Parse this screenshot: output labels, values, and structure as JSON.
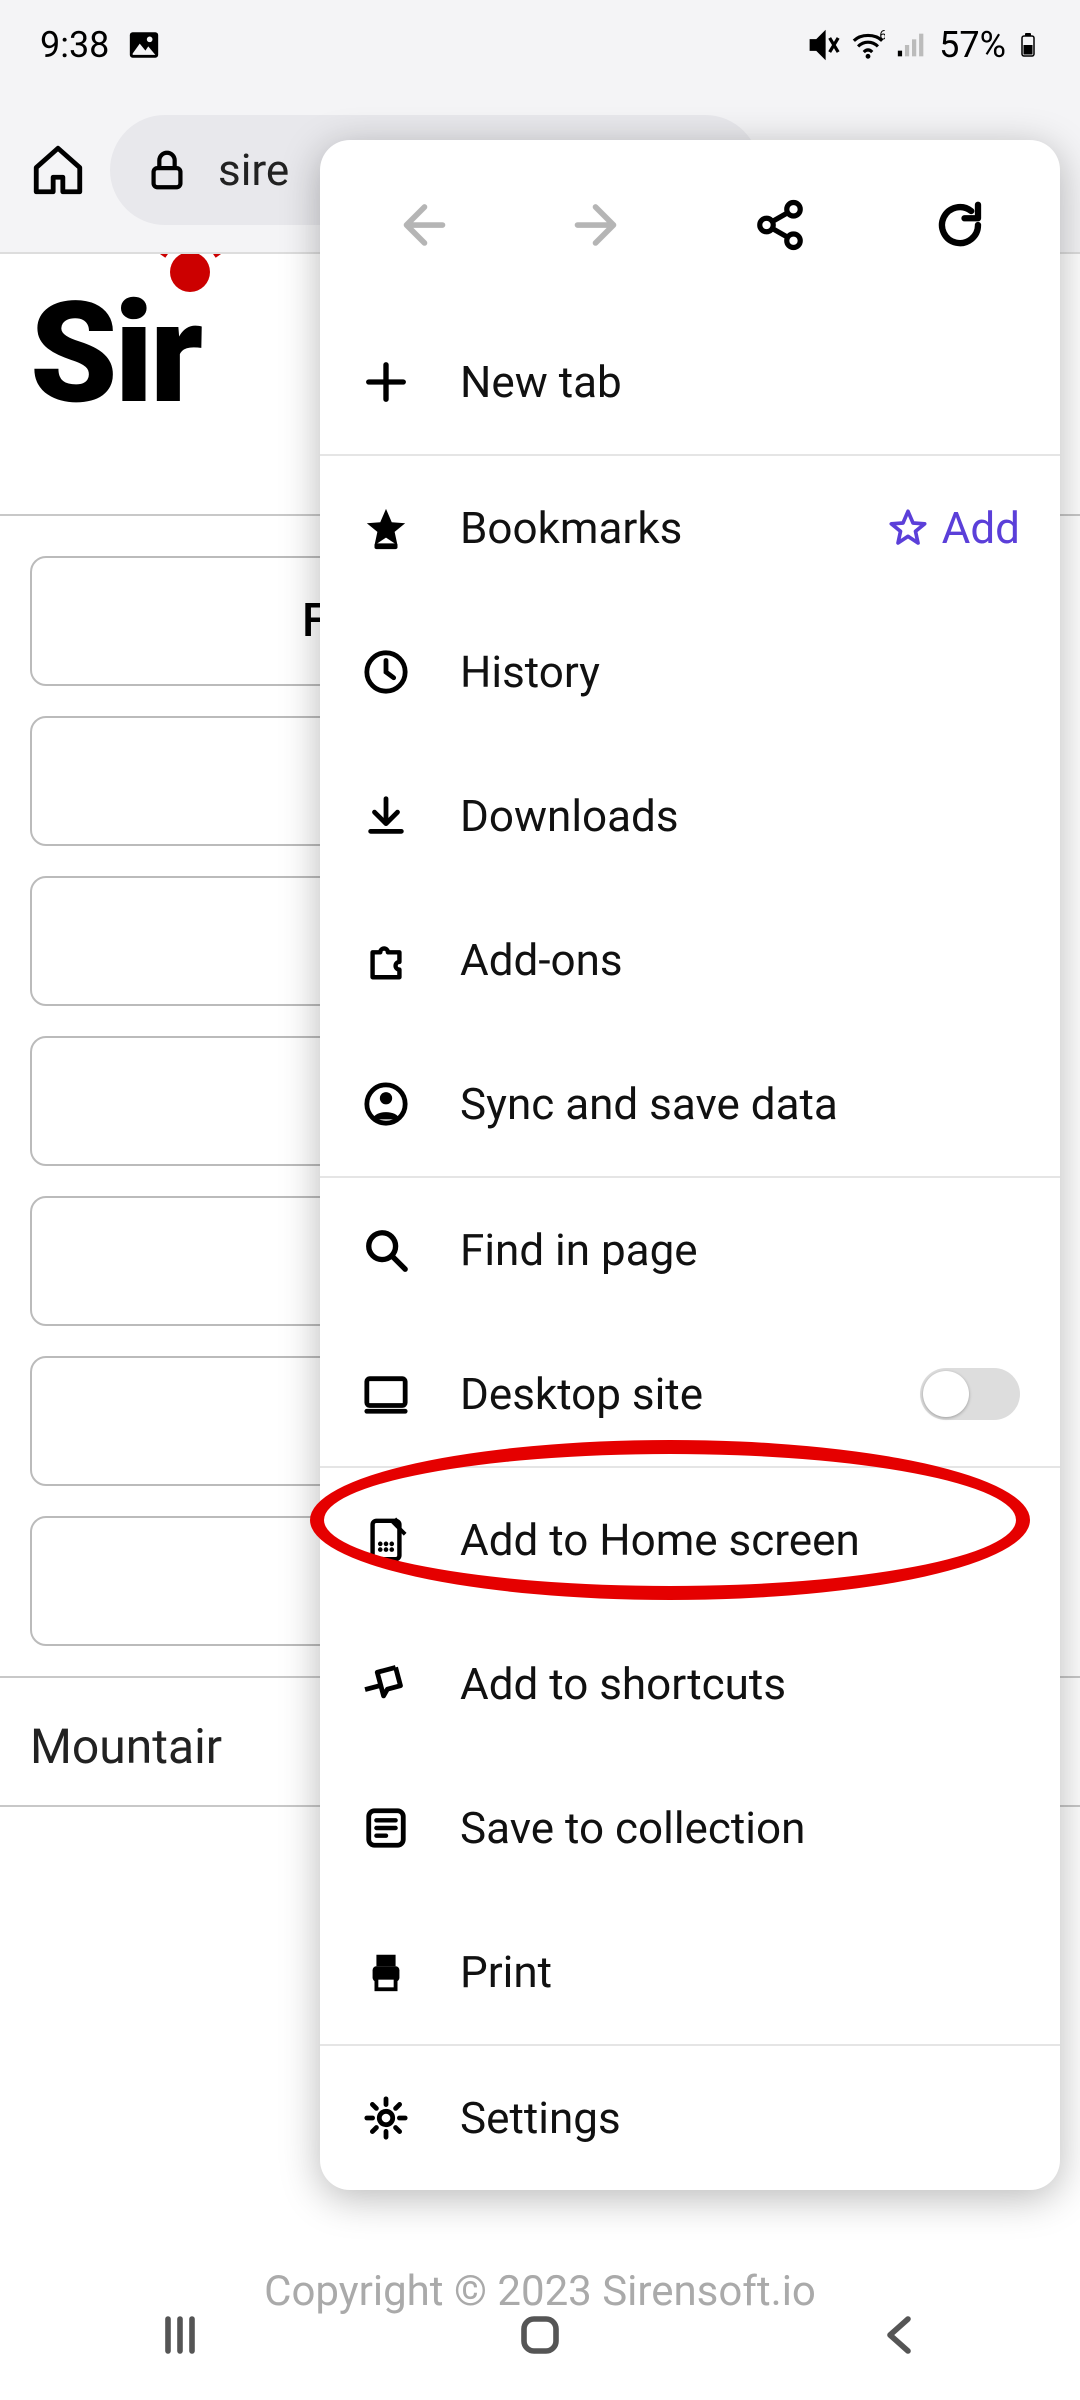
{
  "status": {
    "time": "9:38",
    "battery": "57%"
  },
  "browser": {
    "url_fragment": "sire"
  },
  "page": {
    "brand_fragment": "Sir",
    "row_placeholder": "F",
    "footer": "Mountair",
    "copyright": "Copyright © 2023 Sirensoft.io"
  },
  "menu": {
    "new_tab": "New tab",
    "bookmarks": "Bookmarks",
    "add": "Add",
    "history": "History",
    "downloads": "Downloads",
    "addons": "Add-ons",
    "sync": "Sync and save data",
    "find": "Find in page",
    "desktop": "Desktop site",
    "home_screen": "Add to Home screen",
    "shortcuts": "Add to shortcuts",
    "save_collection": "Save to collection",
    "print": "Print",
    "settings": "Settings"
  }
}
